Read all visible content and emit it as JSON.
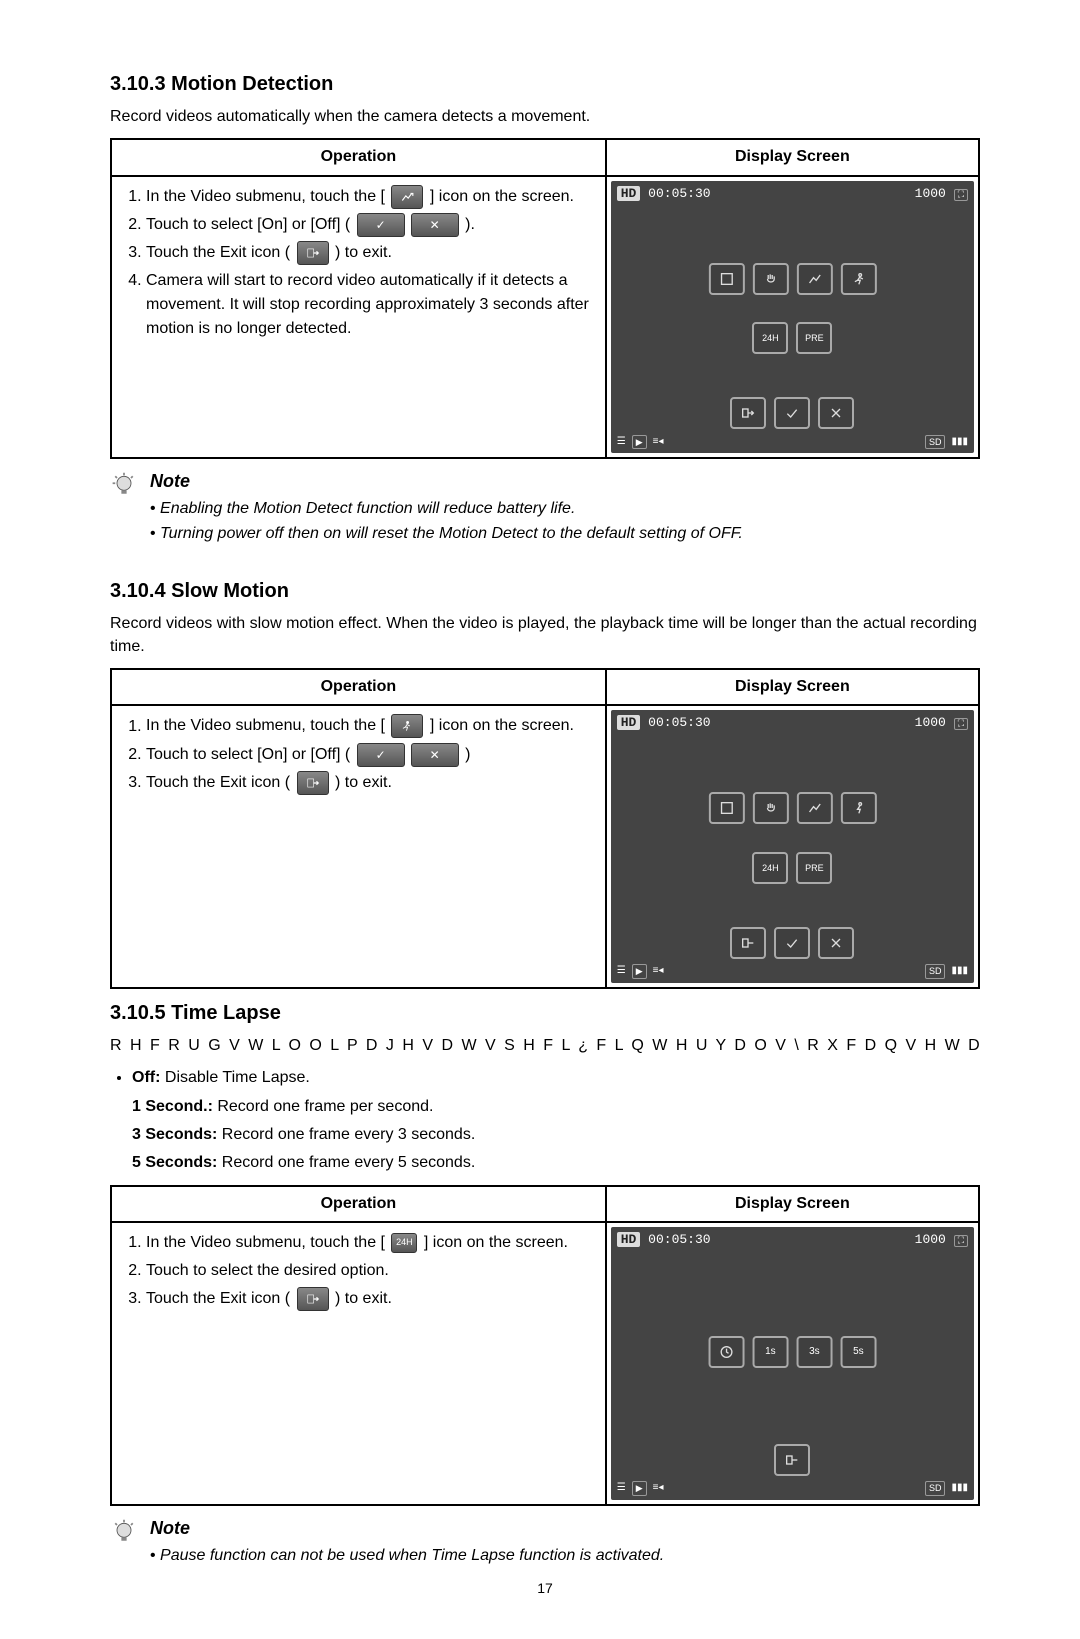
{
  "sections": [
    {
      "heading": "3.10.3 Motion Detection",
      "intro": "Record videos automatically when the camera detects a movement.",
      "table": {
        "col_operation": "Operation",
        "col_screen": "Display Screen",
        "steps": [
          {
            "pre": "In the  Video submenu, touch the [",
            "icon": "motion",
            "post": "] icon on the screen."
          },
          {
            "pre": "Touch to select [On] or [Off] (",
            "icon": "onoff",
            "post": ")."
          },
          {
            "pre": "Touch the Exit icon (",
            "icon": "exit",
            "post": ") to exit."
          },
          {
            "text": "Camera will start to record video automatically if it detects a movement. It will stop recording approximately 3 seconds after motion is no longer detected."
          }
        ],
        "screen": {
          "time": "00:05:30",
          "count": "1000",
          "layout": "six"
        }
      },
      "note": {
        "title": "Note",
        "items": [
          "Enabling the Motion Detect function will reduce battery life.",
          "Turning power off then on will reset the Motion Detect to the default setting of OFF."
        ]
      }
    },
    {
      "heading": "3.10.4 Slow Motion",
      "intro": "Record videos with slow motion effect. When the video is played, the playback time will be longer than the actual recording time.",
      "table": {
        "col_operation": "Operation",
        "col_screen": "Display Screen",
        "steps": [
          {
            "pre": "In the  Video submenu, touch the [",
            "icon": "slow",
            "post": "] icon on the screen."
          },
          {
            "pre": "Touch to select [On] or [Off] (",
            "icon": "onoff",
            "post": ")"
          },
          {
            "pre": "Touch the Exit icon (",
            "icon": "exit",
            "post": ") to exit."
          }
        ],
        "screen": {
          "time": "00:05:30",
          "count": "1000",
          "layout": "five"
        }
      }
    },
    {
      "heading": "3.10.5 Time Lapse",
      "intro_garbled": "R H F R U G   V W L O O   L P D J H V   D W   V S H F L ¿ F   L Q W H U Y D O V   \\ R X   F D Q   V H W   D Q G   S",
      "options": [
        {
          "label": "Off:",
          "desc": " Disable Time Lapse."
        },
        {
          "label": "1 Second.:",
          "desc": " Record one frame per second."
        },
        {
          "label": "3 Seconds:",
          "desc": " Record one frame every 3 seconds."
        },
        {
          "label": "5 Seconds:",
          "desc": " Record one frame every 5 seconds."
        }
      ],
      "table": {
        "col_operation": "Operation",
        "col_screen": "Display Screen",
        "steps": [
          {
            "pre": "In the  Video submenu, touch the [",
            "icon": "24h",
            "post": "] icon on the screen."
          },
          {
            "text": "Touch to select the desired option."
          },
          {
            "pre": "Touch the Exit icon (",
            "icon": "exit",
            "post": ") to exit."
          }
        ],
        "screen": {
          "time": "00:05:30",
          "count": "1000",
          "layout": "lapse"
        }
      },
      "note": {
        "title": "Note",
        "items": [
          "Pause function can not be used when Time Lapse function is activated."
        ]
      }
    }
  ],
  "page_number": "17",
  "icons": {
    "check": "✓",
    "x": "✕",
    "sd": "SD"
  }
}
